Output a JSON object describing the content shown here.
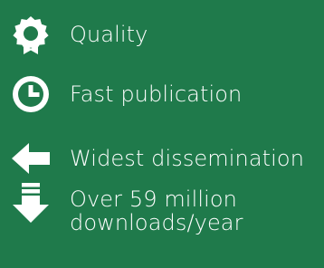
{
  "background_color": "#1f7a4b",
  "text_color": "#ffffff",
  "features": [
    {
      "icon": "award-icon",
      "label": "Quality"
    },
    {
      "icon": "clock-icon",
      "label": "Fast publication"
    },
    {
      "icon": "arrow-left-icon",
      "label": "Widest dissemination"
    },
    {
      "icon": "download-icon",
      "label_line1": "Over 59 million",
      "label_line2": "downloads/year"
    }
  ]
}
